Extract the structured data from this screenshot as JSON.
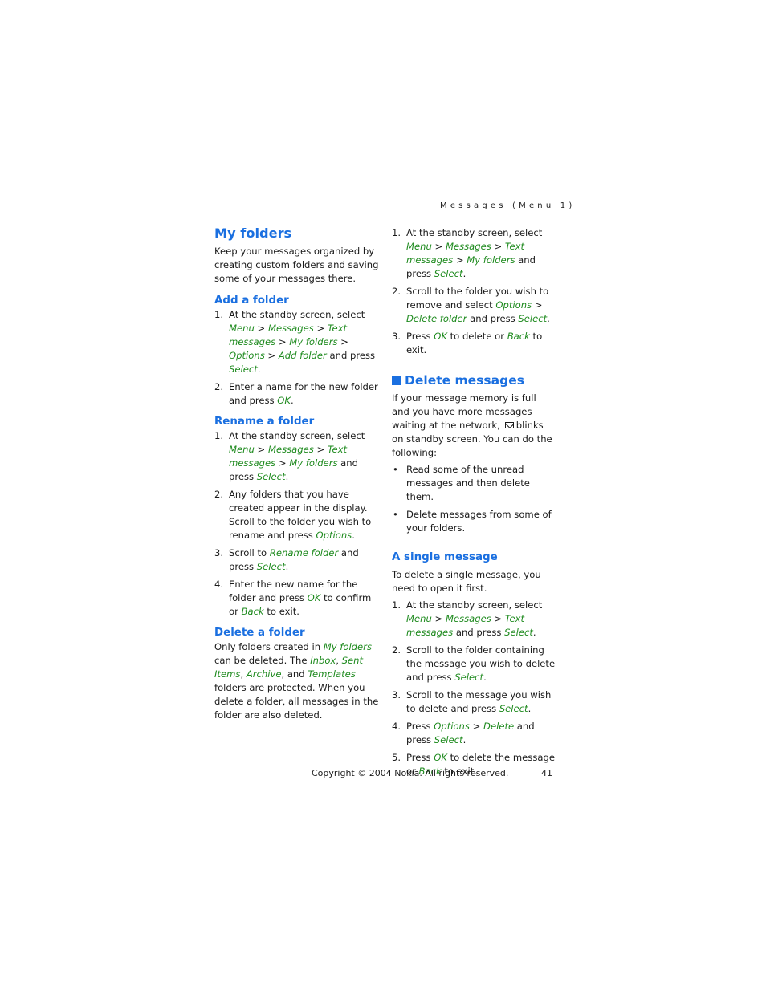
{
  "running_head": "Messages (Menu 1)",
  "left_column": {
    "my_folders": {
      "title": "My folders",
      "intro": "Keep your messages organized by creating custom folders and saving some of your messages there."
    },
    "add_folder": {
      "title": "Add a folder",
      "steps": [
        {
          "num": "1.",
          "parts": [
            {
              "t": "At the standby screen, select "
            },
            {
              "t": "Menu",
              "k": "menu"
            },
            {
              "t": " > "
            },
            {
              "t": "Messages",
              "k": "menu"
            },
            {
              "t": " > "
            },
            {
              "t": "Text messages",
              "k": "menu"
            },
            {
              "t": " > "
            },
            {
              "t": "My folders",
              "k": "menu"
            },
            {
              "t": " > "
            },
            {
              "t": "Options",
              "k": "menu"
            },
            {
              "t": " > "
            },
            {
              "t": "Add folder",
              "k": "menu"
            },
            {
              "t": " and press "
            },
            {
              "t": "Select",
              "k": "menu"
            },
            {
              "t": "."
            }
          ]
        },
        {
          "num": "2.",
          "parts": [
            {
              "t": "Enter a name for the new folder and press "
            },
            {
              "t": "OK",
              "k": "menu"
            },
            {
              "t": "."
            }
          ]
        }
      ]
    },
    "rename_folder": {
      "title": "Rename a folder",
      "steps": [
        {
          "num": "1.",
          "parts": [
            {
              "t": "At the standby screen, select "
            },
            {
              "t": "Menu",
              "k": "menu"
            },
            {
              "t": " > "
            },
            {
              "t": "Messages",
              "k": "menu"
            },
            {
              "t": " > "
            },
            {
              "t": "Text messages",
              "k": "menu"
            },
            {
              "t": " > "
            },
            {
              "t": "My folders",
              "k": "menu"
            },
            {
              "t": " and press "
            },
            {
              "t": "Select",
              "k": "menu"
            },
            {
              "t": "."
            }
          ]
        },
        {
          "num": "2.",
          "parts": [
            {
              "t": "Any folders that you have created appear in the display. Scroll to the folder you wish to rename and press "
            },
            {
              "t": "Options",
              "k": "menu"
            },
            {
              "t": "."
            }
          ]
        },
        {
          "num": "3.",
          "parts": [
            {
              "t": "Scroll to "
            },
            {
              "t": "Rename folder",
              "k": "menu"
            },
            {
              "t": " and press "
            },
            {
              "t": "Select",
              "k": "menu"
            },
            {
              "t": "."
            }
          ]
        },
        {
          "num": "4.",
          "parts": [
            {
              "t": "Enter the new name for the folder and press "
            },
            {
              "t": "OK",
              "k": "menu"
            },
            {
              "t": " to confirm or "
            },
            {
              "t": "Back",
              "k": "menu"
            },
            {
              "t": " to exit."
            }
          ]
        }
      ]
    },
    "delete_folder": {
      "title": "Delete a folder",
      "parts": [
        {
          "t": "Only folders created in "
        },
        {
          "t": "My folders",
          "k": "menu"
        },
        {
          "t": " can be deleted. The "
        },
        {
          "t": "Inbox",
          "k": "menu"
        },
        {
          "t": ", "
        },
        {
          "t": "Sent Items",
          "k": "menu"
        },
        {
          "t": ", "
        },
        {
          "t": "Archive",
          "k": "menu"
        },
        {
          "t": ", and "
        },
        {
          "t": "Templates",
          "k": "menu"
        },
        {
          "t": " folders are protected. When you delete a folder, all messages in the folder are also deleted."
        }
      ]
    }
  },
  "right_column": {
    "delete_folder_steps": [
      {
        "num": "1.",
        "parts": [
          {
            "t": "At the standby screen, select "
          },
          {
            "t": "Menu",
            "k": "menu"
          },
          {
            "t": " > "
          },
          {
            "t": "Messages",
            "k": "menu"
          },
          {
            "t": " > "
          },
          {
            "t": "Text messages",
            "k": "menu"
          },
          {
            "t": " > "
          },
          {
            "t": "My folders",
            "k": "menu"
          },
          {
            "t": " and press "
          },
          {
            "t": "Select",
            "k": "menu"
          },
          {
            "t": "."
          }
        ]
      },
      {
        "num": "2.",
        "parts": [
          {
            "t": "Scroll to the folder you wish to remove and select "
          },
          {
            "t": "Options",
            "k": "menu"
          },
          {
            "t": " > "
          },
          {
            "t": "Delete folder",
            "k": "menu"
          },
          {
            "t": " and press "
          },
          {
            "t": "Select",
            "k": "menu"
          },
          {
            "t": "."
          }
        ]
      },
      {
        "num": "3.",
        "parts": [
          {
            "t": "Press "
          },
          {
            "t": "OK",
            "k": "menu"
          },
          {
            "t": " to delete or "
          },
          {
            "t": "Back",
            "k": "menu"
          },
          {
            "t": " to exit."
          }
        ]
      }
    ],
    "delete_messages": {
      "title": "Delete messages",
      "intro_before_icon": "If your message memory is full and you have more messages waiting at the network,",
      "icon": "envelope-icon",
      "intro_after_icon": "blinks on standby screen. You can do the following:",
      "bullets": [
        "Read some of the unread messages and then delete them.",
        "Delete messages from some of your folders."
      ]
    },
    "single_message": {
      "title": "A single message",
      "intro": "To delete a single message, you need to open it first.",
      "steps": [
        {
          "num": "1.",
          "parts": [
            {
              "t": "At the standby screen, select "
            },
            {
              "t": "Menu",
              "k": "menu"
            },
            {
              "t": " > "
            },
            {
              "t": "Messages",
              "k": "menu"
            },
            {
              "t": " > "
            },
            {
              "t": "Text messages",
              "k": "menu"
            },
            {
              "t": " and press "
            },
            {
              "t": "Select",
              "k": "menu"
            },
            {
              "t": "."
            }
          ]
        },
        {
          "num": "2.",
          "parts": [
            {
              "t": "Scroll to the folder containing the message you wish to delete and press "
            },
            {
              "t": "Select",
              "k": "menu"
            },
            {
              "t": "."
            }
          ]
        },
        {
          "num": "3.",
          "parts": [
            {
              "t": "Scroll to the message you wish to delete and press "
            },
            {
              "t": "Select",
              "k": "menu"
            },
            {
              "t": "."
            }
          ]
        },
        {
          "num": "4.",
          "parts": [
            {
              "t": "Press "
            },
            {
              "t": "Options",
              "k": "menu"
            },
            {
              "t": " > "
            },
            {
              "t": "Delete",
              "k": "menu"
            },
            {
              "t": " and press "
            },
            {
              "t": "Select",
              "k": "menu"
            },
            {
              "t": "."
            }
          ]
        },
        {
          "num": "5.",
          "parts": [
            {
              "t": "Press "
            },
            {
              "t": "OK",
              "k": "menu"
            },
            {
              "t": " to delete the message or "
            },
            {
              "t": "Back",
              "k": "menu"
            },
            {
              "t": " to exit."
            }
          ]
        }
      ]
    }
  },
  "footer": {
    "copyright": "Copyright © 2004 Nokia. All rights reserved.",
    "page_number": "41"
  },
  "colors": {
    "heading": "#1a6fe0",
    "menu_term": "#1e8a1e",
    "body_text": "#1a1a1a"
  }
}
